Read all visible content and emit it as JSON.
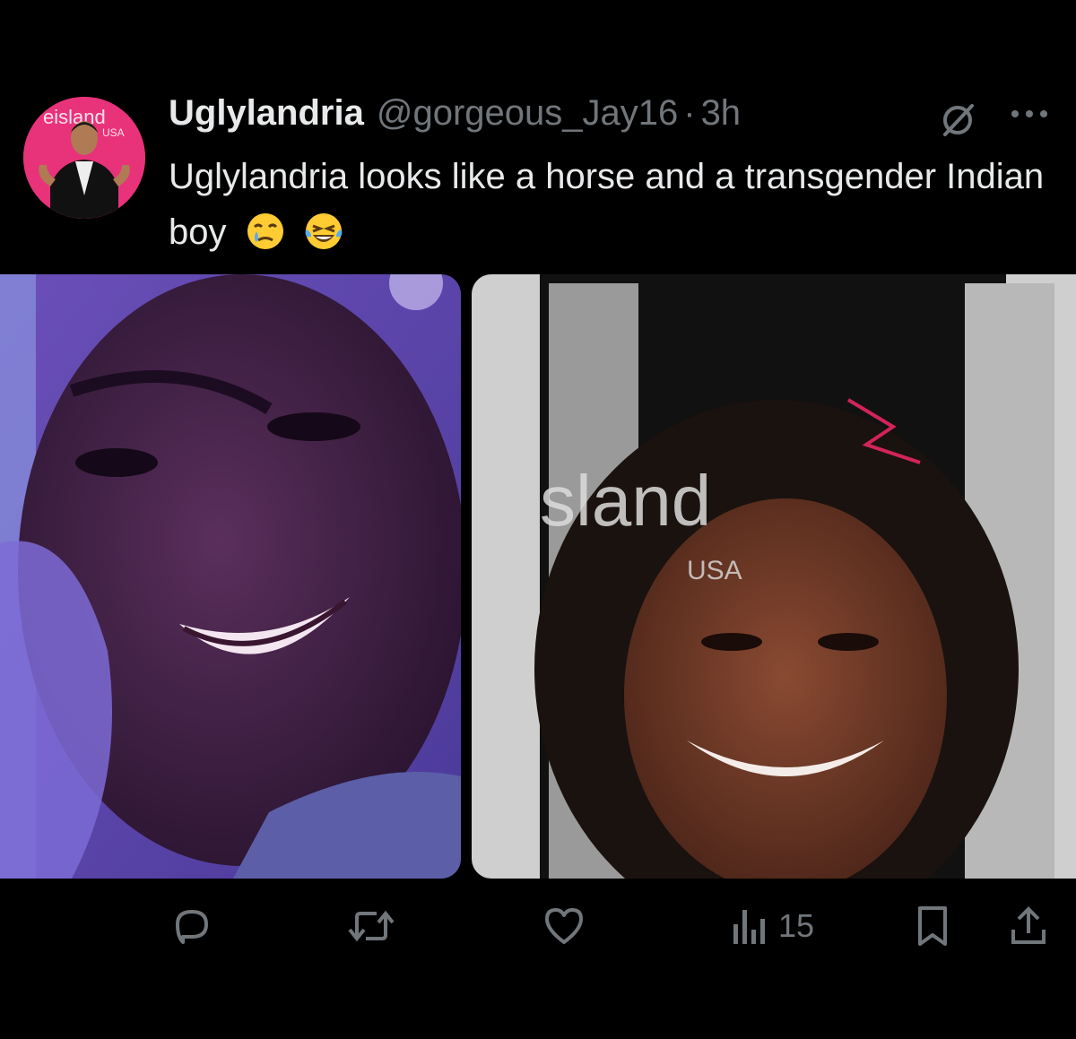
{
  "tweet": {
    "author_name": "Uglylandria",
    "handle": "@gorgeous_Jay16",
    "separator": "·",
    "time": "3h",
    "text": "Uglylandria looks like a horse and a transgender Indian boy",
    "emojis": [
      "crying-face-emoji",
      "laughing-tears-emoji"
    ]
  },
  "avatar": {
    "watermark_text": "eisland",
    "watermark_sub": "USA"
  },
  "media": {
    "right_watermark": "sland",
    "right_watermark_sub": "USA"
  },
  "actions": {
    "reply_icon": "reply-icon",
    "retweet_icon": "retweet-icon",
    "like_icon": "heart-icon",
    "views_icon": "views-icon",
    "views_count": "15",
    "bookmark_icon": "bookmark-icon",
    "share_icon": "share-icon"
  },
  "colors": {
    "background": "#000000",
    "text": "#e7e9ea",
    "muted": "#71767b",
    "avatar_bg": "#e8327a"
  }
}
